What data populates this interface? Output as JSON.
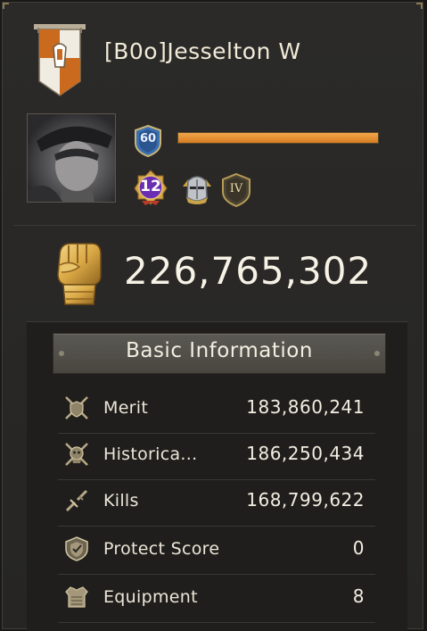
{
  "player": {
    "name": "[B0o]Jesselton W",
    "level": "60",
    "xp_progress": 1.0,
    "vip_level": "12",
    "rank_numeral": "IV"
  },
  "power": {
    "value": "226,765,302",
    "icon": "gauntlet-fist-icon"
  },
  "basic_info": {
    "title": "Basic Information",
    "rows": [
      {
        "label": "Merit",
        "value": "183,860,241",
        "icon": "crossed-swords-shield-icon"
      },
      {
        "label": "Historica...",
        "value": "186,250,434",
        "icon": "crossed-swords-skull-icon"
      },
      {
        "label": "Kills",
        "value": "168,799,622",
        "icon": "broken-sword-icon"
      },
      {
        "label": "Protect Score",
        "value": "0",
        "icon": "protect-shield-icon"
      },
      {
        "label": "Equipment",
        "value": "8",
        "icon": "armor-chestplate-icon"
      }
    ]
  },
  "colors": {
    "xp_bar": "#e08a2c",
    "banner_orange": "#c96a1e",
    "vip_purple": "#6b2fb3",
    "gold": "#d9b45a"
  }
}
